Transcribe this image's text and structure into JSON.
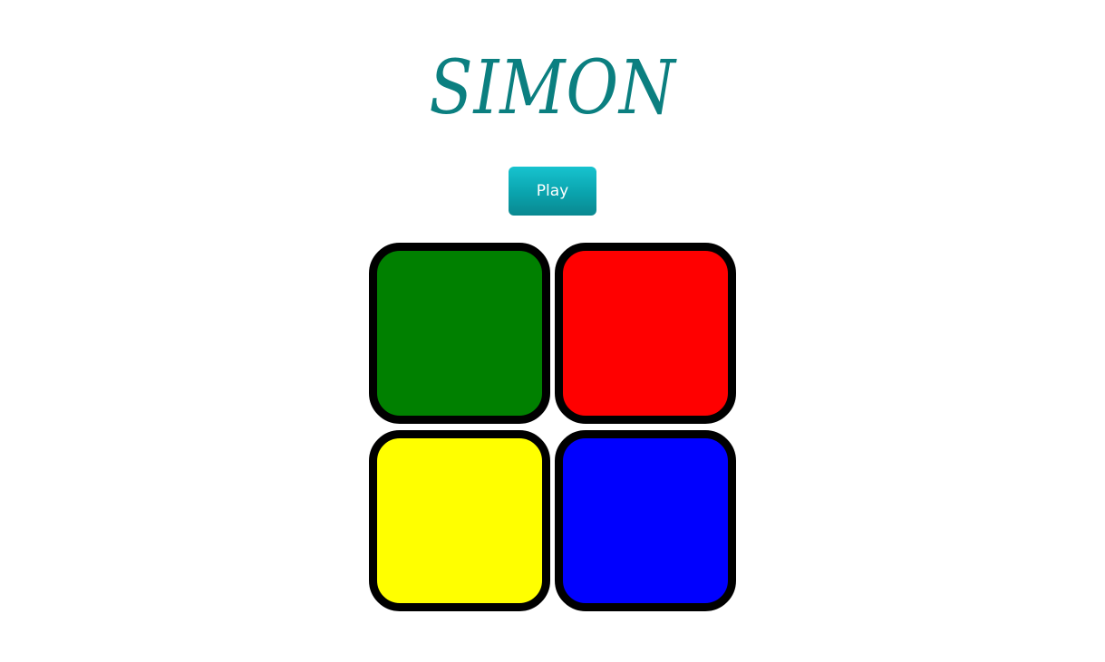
{
  "game": {
    "title": "SIMON",
    "play_label": "Play"
  },
  "pads": [
    {
      "color_name": "green",
      "color": "#008000"
    },
    {
      "color_name": "red",
      "color": "#ff0000"
    },
    {
      "color_name": "yellow",
      "color": "#ffff00"
    },
    {
      "color_name": "blue",
      "color": "#0000ff"
    }
  ],
  "colors": {
    "title": "#0b7f80",
    "button": "#0aa3ad",
    "pad_border": "#000000",
    "background": "#ffffff"
  }
}
